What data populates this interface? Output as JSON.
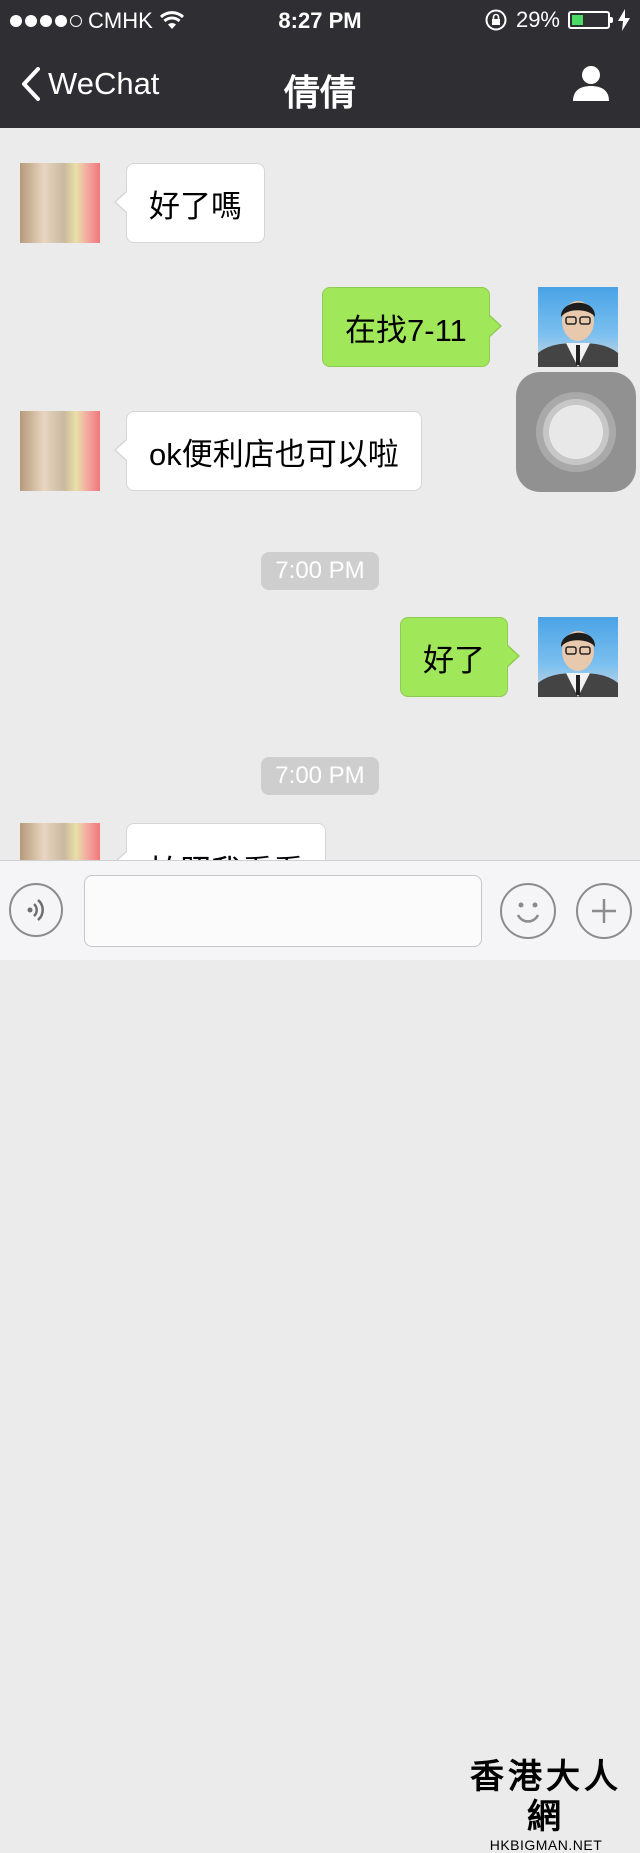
{
  "status_bar": {
    "carrier": "CMHK",
    "time": "8:27 PM",
    "battery_percent": "29%",
    "battery_level": 0.29,
    "signal_bars_filled": 4,
    "signal_bars_total": 5
  },
  "nav": {
    "back_label": "WeChat",
    "title": "倩倩"
  },
  "messages": [
    {
      "from": "contact",
      "text": "好了嗎"
    },
    {
      "from": "me",
      "text": "在找7-11"
    },
    {
      "from": "contact",
      "text": "ok便利店也可以啦"
    },
    {
      "type": "timestamp",
      "text": "7:00 PM"
    },
    {
      "from": "me",
      "text": "好了"
    },
    {
      "type": "timestamp",
      "text": "7:00 PM"
    },
    {
      "from": "contact",
      "text": "拍照我看看"
    }
  ],
  "watermark": {
    "brand": "香港大人網",
    "site": "HKBIGMAN.NET"
  },
  "colors": {
    "nav_bg": "#2e2e33",
    "chat_bg": "#ebebeb",
    "outgoing_bubble": "#a0e75a",
    "incoming_bubble": "#ffffff",
    "battery_fill": "#4cd964"
  }
}
